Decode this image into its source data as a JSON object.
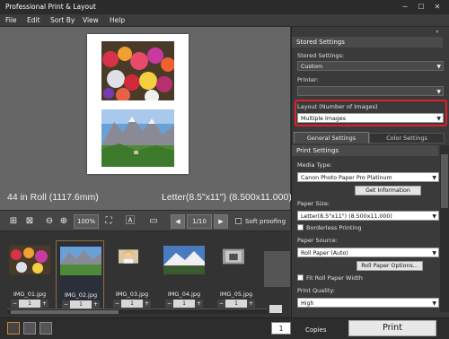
{
  "window": {
    "title": "Professional Print & Layout",
    "minimize": "─",
    "maximize": "☐",
    "close": "✕"
  },
  "menu": [
    "File",
    "Edit",
    "Sort By",
    "View",
    "Help"
  ],
  "preview": {
    "roll_info": "44 in Roll (1117.6mm)",
    "paper_info": "Letter(8.5\"x11\") (8.500x11.000)"
  },
  "toolbar": {
    "zoom": "100%",
    "page": "1/10",
    "soft_proofing": "Soft proofing"
  },
  "thumbnails": [
    {
      "name": "IMG_01.jpg",
      "count": "1",
      "selected": false,
      "color": "#c0465a"
    },
    {
      "name": "IMG_02.jpg",
      "count": "1",
      "selected": true,
      "color": "#5a8a4a"
    },
    {
      "name": "IMG_03.jpg",
      "count": "1",
      "selected": false,
      "color": "#e4c9a0"
    },
    {
      "name": "IMG_04.jpg",
      "count": "1",
      "selected": false,
      "color": "#4a7ac0"
    },
    {
      "name": "IMG_05.jpg",
      "count": "1",
      "selected": false,
      "color": "#888888"
    }
  ],
  "panel": {
    "stored_settings_header": "Stored Settings",
    "stored_settings_label": "Stored Settings:",
    "stored_settings_value": "Custom",
    "printer_label": "Printer:",
    "printer_value": "",
    "layout_label": "Layout (Number of Images)",
    "layout_value": "Multiple Images",
    "tabs": [
      "General Settings",
      "Color Settings"
    ],
    "print_settings_header": "Print Settings",
    "media_type_label": "Media Type:",
    "media_type_value": "Canon Photo Paper Pro Platinum",
    "get_information": "Get Information",
    "paper_size_label": "Paper Size:",
    "paper_size_value": "Letter(8.5\"x11\") (8.500x11.000)",
    "borderless": "Borderless Printing",
    "paper_source_label": "Paper Source:",
    "paper_source_value": "Roll Paper (Auto)",
    "roll_paper_options": "Roll Paper Options...",
    "fit_roll": "Fit Roll Paper Width",
    "print_quality_label": "Print Quality:",
    "print_quality_value": "High"
  },
  "status": {
    "copies": "1",
    "copies_label": "Copies",
    "print": "Print"
  },
  "colors": {
    "highlight": "#e0202a",
    "accent": "#9a6a30"
  }
}
